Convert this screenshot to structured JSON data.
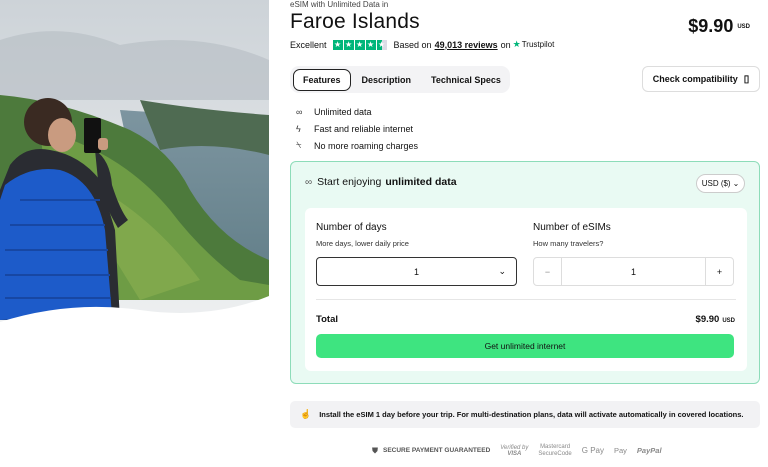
{
  "hero": {
    "image": "faroe-islands-traveler-photo"
  },
  "product": {
    "eyebrow": "eSIM with Unlimited Data in",
    "title": "Faroe Islands",
    "price": "$9.90",
    "currency": "USD"
  },
  "rating": {
    "label": "Excellent",
    "based_on": "Based on",
    "reviews": "49,013 reviews",
    "on": "on",
    "provider": "Trustpilot",
    "stars": 4.5,
    "star_color": "#00b67a"
  },
  "tabs": [
    {
      "label": "Features",
      "active": true
    },
    {
      "label": "Description",
      "active": false
    },
    {
      "label": "Technical Specs",
      "active": false
    }
  ],
  "compat_button": {
    "label": "Check compatibility",
    "icon": "phone-check-icon"
  },
  "features": [
    {
      "icon": "infinity-icon",
      "label": "Unlimited data"
    },
    {
      "icon": "bolt-icon",
      "label": "Fast and reliable internet"
    },
    {
      "icon": "no-roaming-icon",
      "label": "No more roaming charges"
    }
  ],
  "card": {
    "heading_prefix": "Start enjoying",
    "heading_bold": "unlimited data",
    "currency_select": "USD ($)",
    "days_label": "Number of days",
    "days_sub": "More days, lower daily price",
    "days_value": "1",
    "esims_label": "Number of eSIMs",
    "esims_sub": "How many travelers?",
    "esims_value": "1",
    "minus": "−",
    "plus": "+",
    "total_label": "Total",
    "total_value": "$9.90",
    "total_currency": "USD",
    "cta": "Get unlimited internet",
    "accent": "#3ee480"
  },
  "notice": {
    "icon": "tap-icon",
    "text": "Install the eSIM 1 day before your trip. For multi-destination plans, data will activate automatically in covered locations."
  },
  "payments": {
    "secure": "SECURE PAYMENT GUARANTEED",
    "visa_top": "Verified by",
    "visa_bottom": "VISA",
    "mc_top": "Mastercard",
    "mc_bottom": "SecureCode",
    "gpay": "G Pay",
    "apay": " Pay",
    "paypal": "PayPal"
  }
}
